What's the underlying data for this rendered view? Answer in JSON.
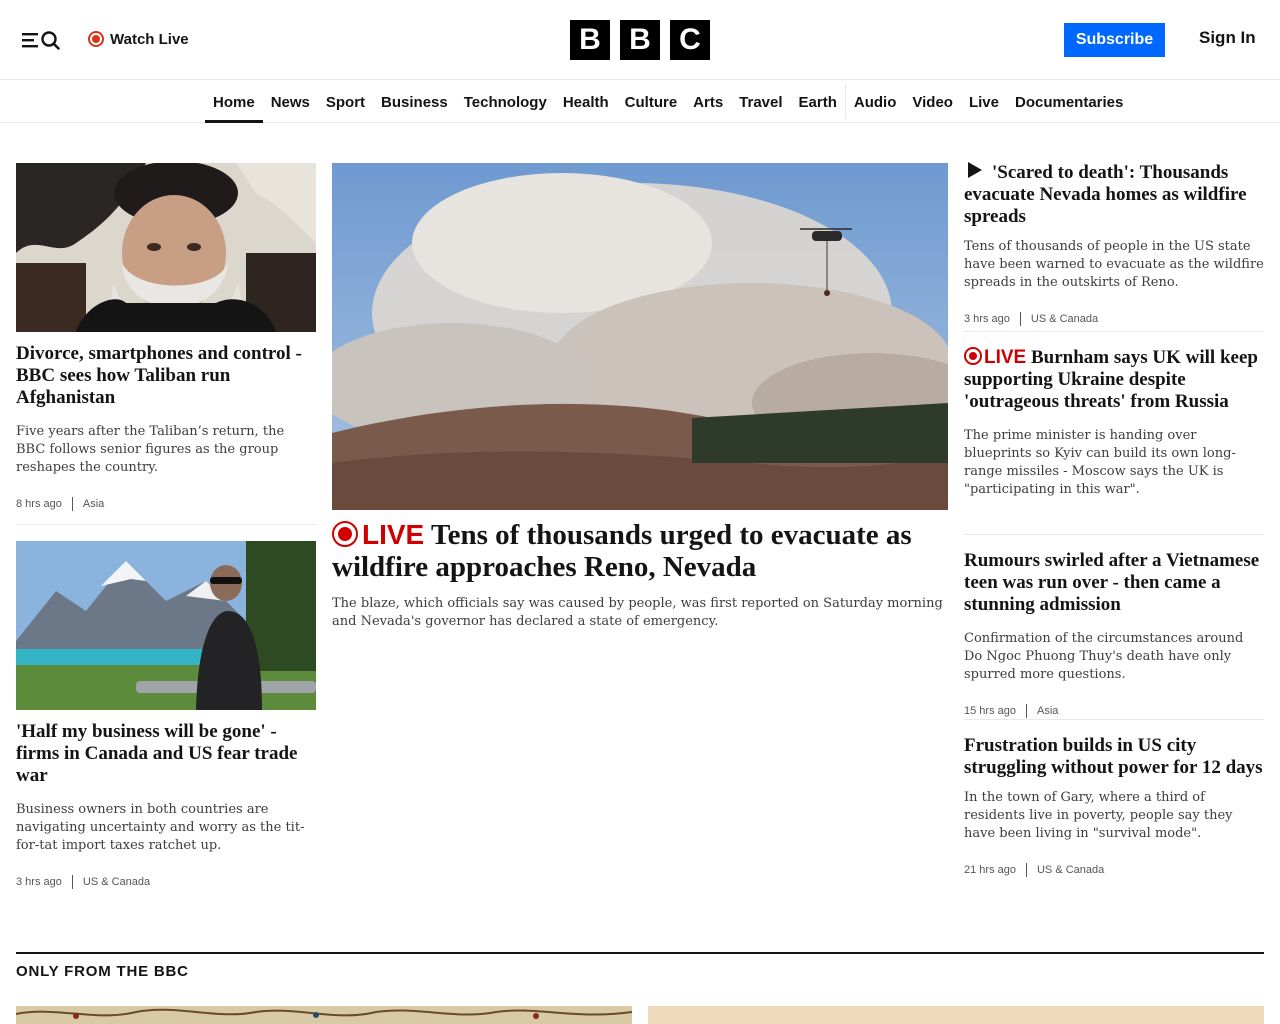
{
  "header": {
    "watch_live": "Watch Live",
    "logo_letters": [
      "B",
      "B",
      "C"
    ],
    "subscribe": "Subscribe",
    "sign_in": "Sign In"
  },
  "nav": {
    "items": [
      "Home",
      "News",
      "Sport",
      "Business",
      "Technology",
      "Health",
      "Culture",
      "Arts",
      "Travel",
      "Earth",
      "Audio",
      "Video",
      "Live",
      "Documentaries"
    ],
    "active": "Home"
  },
  "live_label": "LIVE",
  "left_column": [
    {
      "headline": "Divorce, smartphones and control - BBC sees how Taliban run Afghanistan",
      "summary": "Five years after the Taliban’s return, the BBC follows senior figures as the group reshapes the country.",
      "time": "8 hrs ago",
      "region": "Asia"
    },
    {
      "headline": "'Half my business will be gone' - firms in Canada and US fear trade war",
      "summary": "Business owners in both countries are navigating uncertainty and worry as the tit-for-tat import taxes ratchet up.",
      "time": "3 hrs ago",
      "region": "US & Canada"
    }
  ],
  "lead": {
    "headline": "Tens of thousands urged to evacuate as wildfire approaches Reno, Nevada",
    "summary": "The blaze, which officials say was caused by people, was first reported on Saturday morning and Nevada's governor has declared a state of emergency."
  },
  "right_column": [
    {
      "headline": "'Scared to death': Thousands evacuate Nevada homes as wildfire spreads",
      "summary": "Tens of thousands of people in the US state have been warned to evacuate as the wildfire spreads in the outskirts of Reno.",
      "time": "3 hrs ago",
      "region": "US & Canada"
    },
    {
      "headline": "Burnham says UK will keep supporting Ukraine despite 'outrageous threats' from Russia",
      "summary": "The prime minister is handing over blueprints so Kyiv can build its own long-range missiles - Moscow says the UK is \"participating in this war\"."
    },
    {
      "headline": "Rumours swirled after a Vietnamese teen was run over - then came a stunning admission",
      "summary": "Confirmation of the circumstances around Do Ngoc Phuong Thuy's death have only spurred more questions.",
      "time": "15 hrs ago",
      "region": "Asia"
    },
    {
      "headline": "Frustration builds in US city struggling without power for 12 days",
      "summary": "In the town of Gary, where a third of residents live in poverty, people say they have been living in \"survival mode\".",
      "time": "21 hrs ago",
      "region": "US & Canada"
    }
  ],
  "section": {
    "title": "ONLY FROM THE BBC"
  },
  "colors": {
    "subscribe": "#0068ff",
    "live": "#ce0000",
    "logo": "#000000"
  }
}
